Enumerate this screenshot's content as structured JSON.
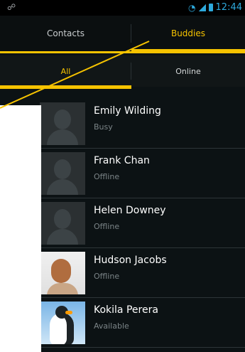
{
  "status_bar": {
    "left_icon": "dev-settings-icon",
    "time": "12:44"
  },
  "tabs": [
    {
      "label": "Contacts",
      "selected": false
    },
    {
      "label": "Buddies",
      "selected": true
    }
  ],
  "subtabs": [
    {
      "label": "All",
      "selected": true
    },
    {
      "label": "Online",
      "selected": false
    }
  ],
  "contacts": [
    {
      "name": "Emily Wilding",
      "presence": "Busy",
      "status": "busy",
      "avatar": "silhouette"
    },
    {
      "name": "Frank Chan",
      "presence": "Offline",
      "status": "offline",
      "avatar": "silhouette"
    },
    {
      "name": "Helen Downey",
      "presence": "Offline",
      "status": "empty",
      "avatar": "silhouette"
    },
    {
      "name": "Hudson Jacobs",
      "presence": "Offline",
      "status": "offline",
      "avatar": "photo-hudson"
    },
    {
      "name": "Kokila Perera",
      "presence": "Available",
      "status": "available",
      "avatar": "photo-kokila"
    }
  ],
  "colors": {
    "accent": "#f6c300",
    "busy": "#c62a24",
    "available": "#1ea34b",
    "background": "#0c1214",
    "text": "#ffffff",
    "subtext": "#7b8487"
  }
}
